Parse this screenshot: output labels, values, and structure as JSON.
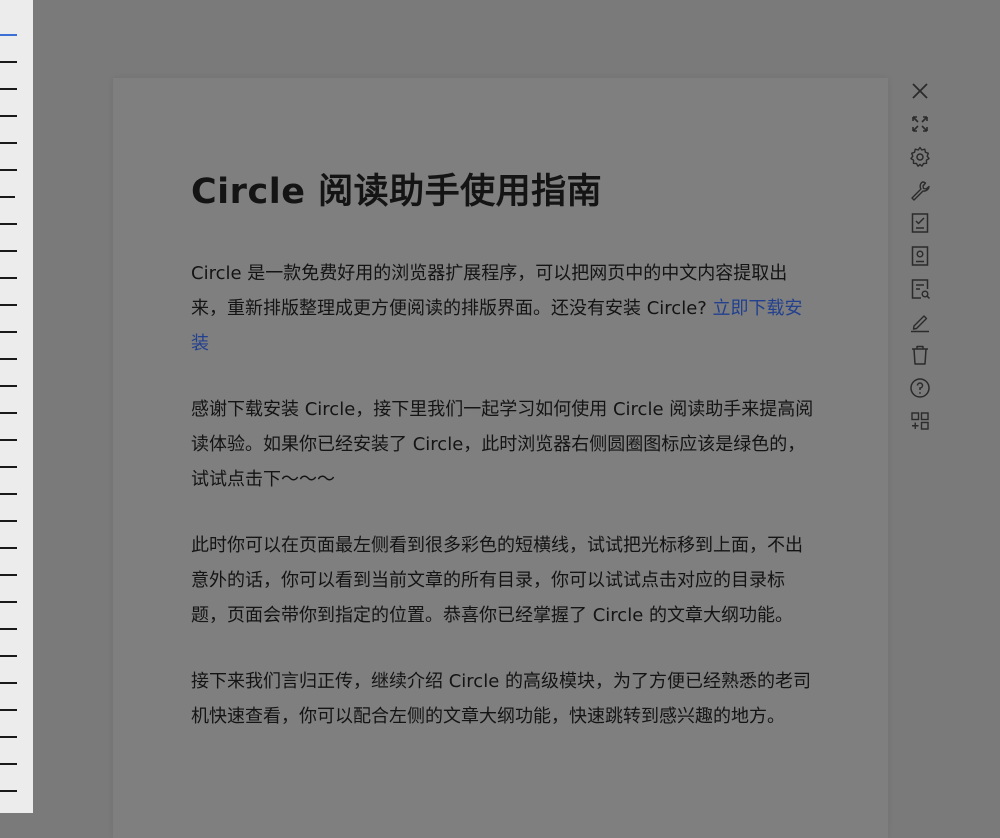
{
  "outline": {
    "dash_count": 29,
    "active_color": "#3b6fd6"
  },
  "article": {
    "title": "Circle 阅读助手使用指南",
    "p1_text": "Circle 是一款免费好用的浏览器扩展程序，可以把网页中的中文内容提取出来，重新排版整理成更方便阅读的排版界面。还没有安装 Circle? ",
    "p1_link": "立即下载安装",
    "p2": "感谢下载安装 Circle，接下里我们一起学习如何使用 Circle 阅读助手来提高阅读体验。如果你已经安装了 Circle，此时浏览器右侧圆圈图标应该是绿色的，试试点击下～～～",
    "p3": "此时你可以在页面最左侧看到很多彩色的短横线，试试把光标移到上面，不出意外的话，你可以看到当前文章的所有目录，你可以试试点击对应的目录标题，页面会带你到指定的位置。恭喜你已经掌握了 Circle 的文章大纲功能。",
    "p4": "接下来我们言归正传，继续介绍 Circle 的高级模块，为了方便已经熟悉的老司机快速查看，你可以配合左侧的文章大纲功能，快速跳转到感兴趣的地方。"
  },
  "toolbar": {
    "icons": [
      "close-icon",
      "fullscreen-icon",
      "settings-icon",
      "wrench-icon",
      "checklist-icon",
      "profile-card-icon",
      "search-document-icon",
      "pen-icon",
      "trash-icon",
      "help-icon",
      "add-apps-icon"
    ]
  },
  "colors": {
    "overlay": "#7a7a7a",
    "card": "#7f7f7f",
    "rail": "#ececec",
    "link": "#23408e"
  }
}
